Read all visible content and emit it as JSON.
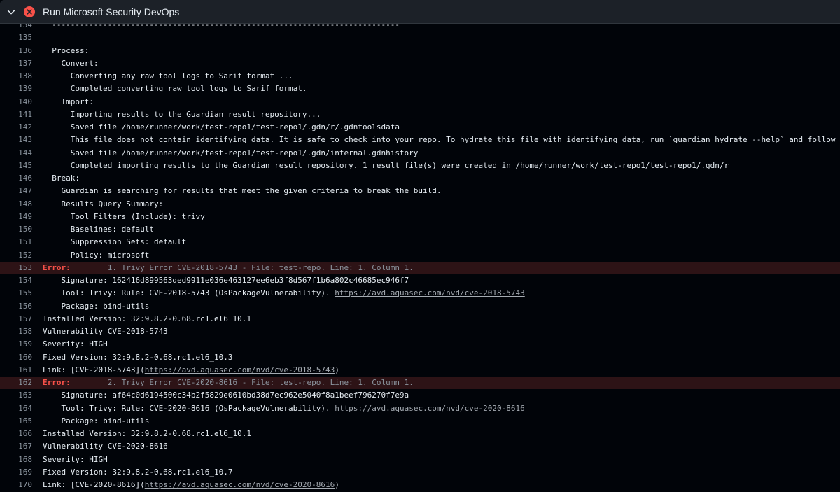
{
  "header": {
    "title": "Run Microsoft Security DevOps",
    "status_icon": "x-circle-icon",
    "status_color": "#f85149"
  },
  "log": {
    "lines": [
      {
        "n": "134",
        "t": "  ---------------------------------------------------------------------------"
      },
      {
        "n": "135",
        "t": ""
      },
      {
        "n": "136",
        "t": "  Process:"
      },
      {
        "n": "137",
        "t": "    Convert:"
      },
      {
        "n": "138",
        "t": "      Converting any raw tool logs to Sarif format ..."
      },
      {
        "n": "139",
        "t": "      Completed converting raw tool logs to Sarif format."
      },
      {
        "n": "140",
        "t": "    Import:"
      },
      {
        "n": "141",
        "t": "      Importing results to the Guardian result repository..."
      },
      {
        "n": "142",
        "t": "      Saved file /home/runner/work/test-repo1/test-repo1/.gdn/r/.gdntoolsdata"
      },
      {
        "n": "143",
        "t": "      This file does not contain identifying data. It is safe to check into your repo. To hydrate this file with identifying data, run `guardian hydrate --help` and follow the guidance."
      },
      {
        "n": "144",
        "t": "      Saved file /home/runner/work/test-repo1/test-repo1/.gdn/internal.gdnhistory"
      },
      {
        "n": "145",
        "t": "      Completed importing results to the Guardian result repository. 1 result file(s) were created in /home/runner/work/test-repo1/test-repo1/.gdn/r"
      },
      {
        "n": "146",
        "t": "  Break:"
      },
      {
        "n": "147",
        "t": "    Guardian is searching for results that meet the given criteria to break the build."
      },
      {
        "n": "148",
        "t": "    Results Query Summary:"
      },
      {
        "n": "149",
        "t": "      Tool Filters (Include): trivy"
      },
      {
        "n": "150",
        "t": "      Baselines: default"
      },
      {
        "n": "151",
        "t": "      Suppression Sets: default"
      },
      {
        "n": "152",
        "t": "      Policy: microsoft"
      },
      {
        "n": "153",
        "error": true,
        "label": "Error:",
        "t": "        1. Trivy Error CVE-2018-5743 - File: test-repo. Line: 1. Column 1."
      },
      {
        "n": "154",
        "t": "    Signature: 162416d899563ded9911e036e463127ee6eb3f8d567f1b6a802c46685ec946f7"
      },
      {
        "n": "155",
        "t": "    Tool: Trivy: Rule: CVE-2018-5743 (OsPackageVulnerability). ",
        "link": "https://avd.aquasec.com/nvd/cve-2018-5743"
      },
      {
        "n": "156",
        "t": "    Package: bind-utils"
      },
      {
        "n": "157",
        "t": "Installed Version: 32:9.8.2-0.68.rc1.el6_10.1"
      },
      {
        "n": "158",
        "t": "Vulnerability CVE-2018-5743"
      },
      {
        "n": "159",
        "t": "Severity: HIGH"
      },
      {
        "n": "160",
        "t": "Fixed Version: 32:9.8.2-0.68.rc1.el6_10.3"
      },
      {
        "n": "161",
        "t": "Link: [CVE-2018-5743](",
        "link": "https://avd.aquasec.com/nvd/cve-2018-5743",
        "after": ")"
      },
      {
        "n": "162",
        "error": true,
        "label": "Error:",
        "t": "        2. Trivy Error CVE-2020-8616 - File: test-repo. Line: 1. Column 1."
      },
      {
        "n": "163",
        "t": "    Signature: af64c0d6194500c34b2f5829e0610bd38d7ec962e5040f8a1beef796270f7e9a"
      },
      {
        "n": "164",
        "t": "    Tool: Trivy: Rule: CVE-2020-8616 (OsPackageVulnerability). ",
        "link": "https://avd.aquasec.com/nvd/cve-2020-8616"
      },
      {
        "n": "165",
        "t": "    Package: bind-utils"
      },
      {
        "n": "166",
        "t": "Installed Version: 32:9.8.2-0.68.rc1.el6_10.1"
      },
      {
        "n": "167",
        "t": "Vulnerability CVE-2020-8616"
      },
      {
        "n": "168",
        "t": "Severity: HIGH"
      },
      {
        "n": "169",
        "t": "Fixed Version: 32:9.8.2-0.68.rc1.el6_10.7"
      },
      {
        "n": "170",
        "t": "Link: [CVE-2020-8616](",
        "link": "https://avd.aquasec.com/nvd/cve-2020-8616",
        "after": ")"
      }
    ]
  }
}
